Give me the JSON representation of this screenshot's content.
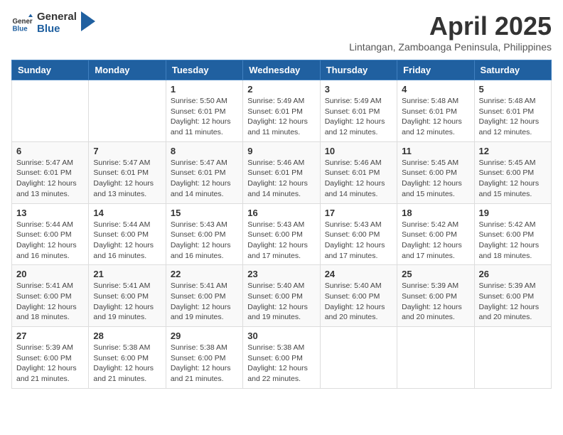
{
  "header": {
    "logo_general": "General",
    "logo_blue": "Blue",
    "month_year": "April 2025",
    "location": "Lintangan, Zamboanga Peninsula, Philippines"
  },
  "weekdays": [
    "Sunday",
    "Monday",
    "Tuesday",
    "Wednesday",
    "Thursday",
    "Friday",
    "Saturday"
  ],
  "weeks": [
    [
      {
        "day": "",
        "info": ""
      },
      {
        "day": "",
        "info": ""
      },
      {
        "day": "1",
        "info": "Sunrise: 5:50 AM\nSunset: 6:01 PM\nDaylight: 12 hours and 11 minutes."
      },
      {
        "day": "2",
        "info": "Sunrise: 5:49 AM\nSunset: 6:01 PM\nDaylight: 12 hours and 11 minutes."
      },
      {
        "day": "3",
        "info": "Sunrise: 5:49 AM\nSunset: 6:01 PM\nDaylight: 12 hours and 12 minutes."
      },
      {
        "day": "4",
        "info": "Sunrise: 5:48 AM\nSunset: 6:01 PM\nDaylight: 12 hours and 12 minutes."
      },
      {
        "day": "5",
        "info": "Sunrise: 5:48 AM\nSunset: 6:01 PM\nDaylight: 12 hours and 12 minutes."
      }
    ],
    [
      {
        "day": "6",
        "info": "Sunrise: 5:47 AM\nSunset: 6:01 PM\nDaylight: 12 hours and 13 minutes."
      },
      {
        "day": "7",
        "info": "Sunrise: 5:47 AM\nSunset: 6:01 PM\nDaylight: 12 hours and 13 minutes."
      },
      {
        "day": "8",
        "info": "Sunrise: 5:47 AM\nSunset: 6:01 PM\nDaylight: 12 hours and 14 minutes."
      },
      {
        "day": "9",
        "info": "Sunrise: 5:46 AM\nSunset: 6:01 PM\nDaylight: 12 hours and 14 minutes."
      },
      {
        "day": "10",
        "info": "Sunrise: 5:46 AM\nSunset: 6:01 PM\nDaylight: 12 hours and 14 minutes."
      },
      {
        "day": "11",
        "info": "Sunrise: 5:45 AM\nSunset: 6:00 PM\nDaylight: 12 hours and 15 minutes."
      },
      {
        "day": "12",
        "info": "Sunrise: 5:45 AM\nSunset: 6:00 PM\nDaylight: 12 hours and 15 minutes."
      }
    ],
    [
      {
        "day": "13",
        "info": "Sunrise: 5:44 AM\nSunset: 6:00 PM\nDaylight: 12 hours and 16 minutes."
      },
      {
        "day": "14",
        "info": "Sunrise: 5:44 AM\nSunset: 6:00 PM\nDaylight: 12 hours and 16 minutes."
      },
      {
        "day": "15",
        "info": "Sunrise: 5:43 AM\nSunset: 6:00 PM\nDaylight: 12 hours and 16 minutes."
      },
      {
        "day": "16",
        "info": "Sunrise: 5:43 AM\nSunset: 6:00 PM\nDaylight: 12 hours and 17 minutes."
      },
      {
        "day": "17",
        "info": "Sunrise: 5:43 AM\nSunset: 6:00 PM\nDaylight: 12 hours and 17 minutes."
      },
      {
        "day": "18",
        "info": "Sunrise: 5:42 AM\nSunset: 6:00 PM\nDaylight: 12 hours and 17 minutes."
      },
      {
        "day": "19",
        "info": "Sunrise: 5:42 AM\nSunset: 6:00 PM\nDaylight: 12 hours and 18 minutes."
      }
    ],
    [
      {
        "day": "20",
        "info": "Sunrise: 5:41 AM\nSunset: 6:00 PM\nDaylight: 12 hours and 18 minutes."
      },
      {
        "day": "21",
        "info": "Sunrise: 5:41 AM\nSunset: 6:00 PM\nDaylight: 12 hours and 19 minutes."
      },
      {
        "day": "22",
        "info": "Sunrise: 5:41 AM\nSunset: 6:00 PM\nDaylight: 12 hours and 19 minutes."
      },
      {
        "day": "23",
        "info": "Sunrise: 5:40 AM\nSunset: 6:00 PM\nDaylight: 12 hours and 19 minutes."
      },
      {
        "day": "24",
        "info": "Sunrise: 5:40 AM\nSunset: 6:00 PM\nDaylight: 12 hours and 20 minutes."
      },
      {
        "day": "25",
        "info": "Sunrise: 5:39 AM\nSunset: 6:00 PM\nDaylight: 12 hours and 20 minutes."
      },
      {
        "day": "26",
        "info": "Sunrise: 5:39 AM\nSunset: 6:00 PM\nDaylight: 12 hours and 20 minutes."
      }
    ],
    [
      {
        "day": "27",
        "info": "Sunrise: 5:39 AM\nSunset: 6:00 PM\nDaylight: 12 hours and 21 minutes."
      },
      {
        "day": "28",
        "info": "Sunrise: 5:38 AM\nSunset: 6:00 PM\nDaylight: 12 hours and 21 minutes."
      },
      {
        "day": "29",
        "info": "Sunrise: 5:38 AM\nSunset: 6:00 PM\nDaylight: 12 hours and 21 minutes."
      },
      {
        "day": "30",
        "info": "Sunrise: 5:38 AM\nSunset: 6:00 PM\nDaylight: 12 hours and 22 minutes."
      },
      {
        "day": "",
        "info": ""
      },
      {
        "day": "",
        "info": ""
      },
      {
        "day": "",
        "info": ""
      }
    ]
  ]
}
